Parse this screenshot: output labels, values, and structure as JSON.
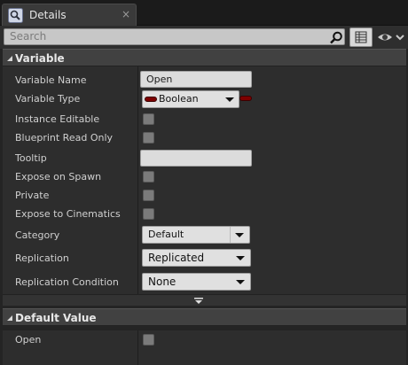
{
  "tab": {
    "title": "Details",
    "close": "×",
    "icon": "details-magnifier-icon"
  },
  "search": {
    "placeholder": "Search"
  },
  "colors": {
    "boolean_pin": "#7d0000",
    "panel_bg": "#2d2d2d",
    "header_bg": "#414141"
  },
  "variable_section": {
    "title": "Variable",
    "rows": [
      {
        "label": "Variable Name",
        "type": "text",
        "value": "Open"
      },
      {
        "label": "Variable Type",
        "type": "type-combo",
        "value": "Boolean"
      },
      {
        "label": "Instance Editable",
        "type": "checkbox",
        "checked": false
      },
      {
        "label": "Blueprint Read Only",
        "type": "checkbox",
        "checked": false
      },
      {
        "label": "Tooltip",
        "type": "text",
        "value": ""
      },
      {
        "label": "Expose on Spawn",
        "type": "checkbox",
        "checked": false
      },
      {
        "label": "Private",
        "type": "checkbox",
        "checked": false
      },
      {
        "label": "Expose to Cinematics",
        "type": "checkbox",
        "checked": false
      },
      {
        "label": "Category",
        "type": "combo",
        "value": "Default"
      },
      {
        "label": "Replication",
        "type": "combo",
        "value": "Replicated"
      },
      {
        "label": "Replication Condition",
        "type": "combo",
        "value": "None"
      }
    ]
  },
  "default_section": {
    "title": "Default Value",
    "rows": [
      {
        "label": "Open",
        "type": "checkbox",
        "checked": false
      }
    ]
  }
}
